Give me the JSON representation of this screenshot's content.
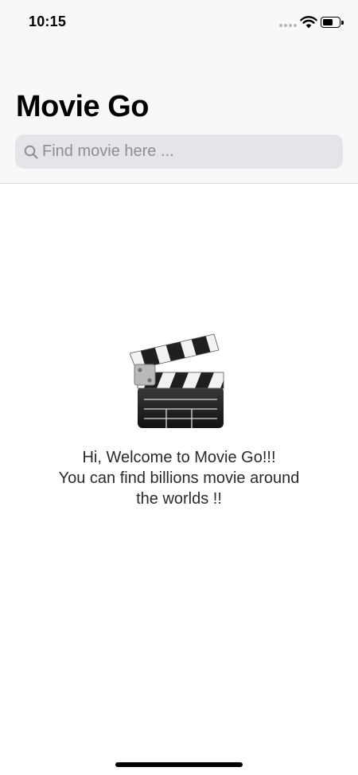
{
  "status_bar": {
    "time": "10:15",
    "signal_icon": "signal-dots-icon",
    "wifi_icon": "wifi-icon",
    "battery_icon": "battery-icon"
  },
  "header": {
    "title": "Movie Go"
  },
  "search": {
    "placeholder": "Find movie here ...",
    "value": "",
    "icon": "search-icon"
  },
  "empty_state": {
    "icon": "clapper-board-icon",
    "lines": [
      "Hi, Welcome to Movie Go!!!",
      "You can find billions movie around",
      "the worlds !!"
    ]
  },
  "colors": {
    "nav_background": "#f8f8f8",
    "search_background": "#e4e5e8",
    "placeholder": "#8e8e93",
    "text": "#2a2a2a"
  }
}
